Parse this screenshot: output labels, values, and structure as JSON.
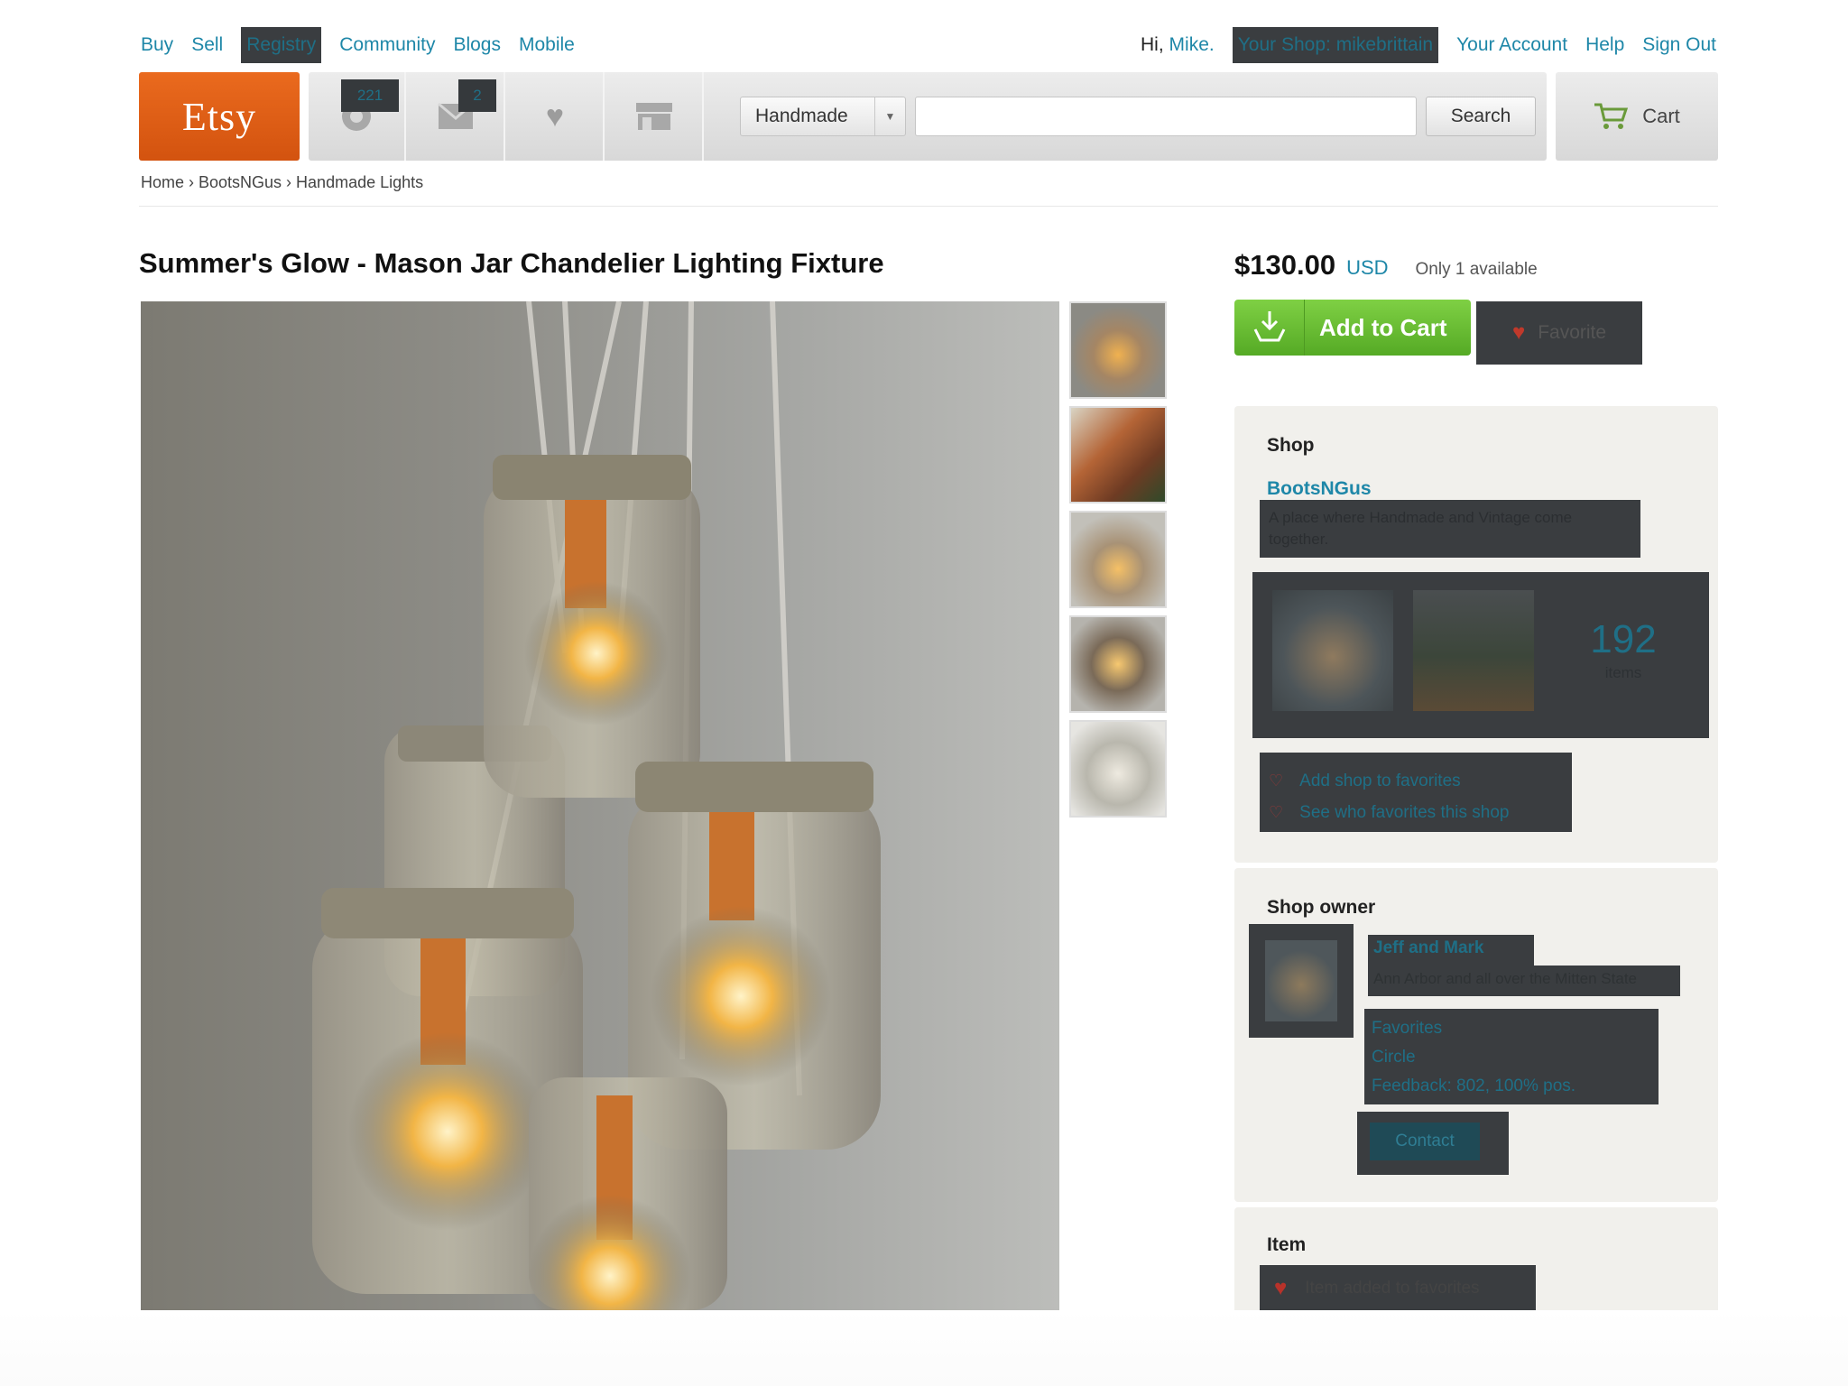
{
  "topnav": {
    "left": [
      "Buy",
      "Sell",
      "Registry",
      "Community",
      "Blogs",
      "Mobile"
    ],
    "greeting_prefix": "Hi,",
    "user_name": "Mike.",
    "your_shop": "Your Shop: mikebrittain",
    "your_account": "Your Account",
    "help": "Help",
    "sign_out": "Sign Out"
  },
  "header": {
    "logo": "Etsy",
    "activity_count": "221",
    "message_count": "2",
    "category": "Handmade",
    "search_value": "",
    "search_button": "Search",
    "cart_label": "Cart"
  },
  "breadcrumb": "Home › BootsNGus › Handmade Lights",
  "listing": {
    "title": "Summer's Glow - Mason Jar Chandelier Lighting Fixture",
    "price": "$130.00",
    "currency": "USD",
    "availability": "Only 1 available",
    "add_to_cart": "Add to Cart",
    "favorite": "Favorite"
  },
  "shop": {
    "heading": "Shop",
    "name": "BootsNGus",
    "tagline": "A place where Handmade and Vintage come together.",
    "items_count": "192",
    "items_label": "items",
    "add_favorites": "Add shop to favorites",
    "see_favorites": "See who favorites this shop"
  },
  "owner": {
    "heading": "Shop owner",
    "name": "Jeff and Mark",
    "location": "Ann Arbor and all over the Mitten State",
    "favorites": "Favorites",
    "circle": "Circle",
    "feedback": "Feedback: 802, 100% pos.",
    "contact": "Contact"
  },
  "item": {
    "heading": "Item",
    "added": "Item added to favorites"
  },
  "colors": {
    "accent": "#1e87a8",
    "etsy_orange": "#d8571a",
    "cart_green": "#62b52f",
    "redaction": "#3a3d40"
  }
}
